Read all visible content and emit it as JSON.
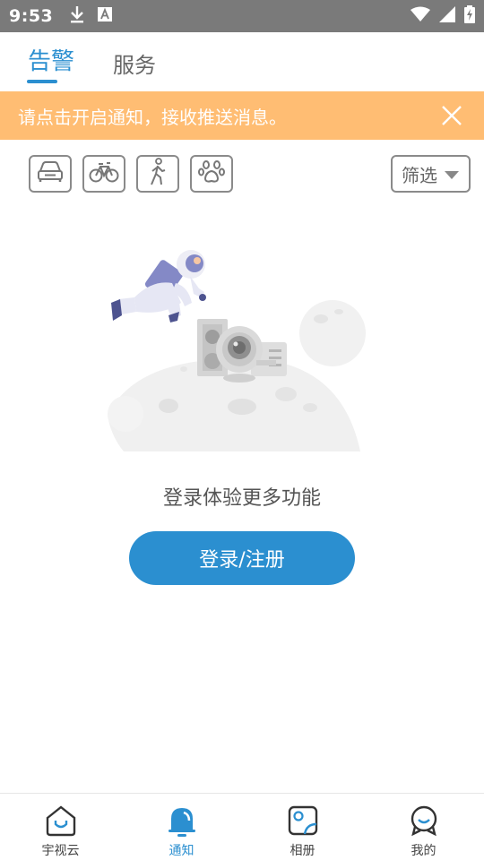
{
  "status_bar": {
    "time": "9:53",
    "left_icons": [
      "download-icon",
      "a-letter-icon"
    ],
    "right_icons": [
      "wifi-icon",
      "signal-icon",
      "battery-charging-icon"
    ]
  },
  "tabs": [
    {
      "label": "告警",
      "active": true
    },
    {
      "label": "服务",
      "active": false
    }
  ],
  "notice": {
    "text": "请点击开启通知，接收推送消息。",
    "close_icon": "close-icon",
    "color": "#ffbd73"
  },
  "filter": {
    "categories": [
      "car-icon",
      "bicycle-icon",
      "pedestrian-icon",
      "paw-icon"
    ],
    "select_label": "筛选"
  },
  "empty_state": {
    "illustration": "astronaut-moon-camera-illustration",
    "message": "登录体验更多功能",
    "button_label": "登录/注册"
  },
  "bottom_nav": [
    {
      "label": "宇视云",
      "icon": "home-icon",
      "active": false
    },
    {
      "label": "通知",
      "icon": "bell-icon",
      "active": true
    },
    {
      "label": "相册",
      "icon": "album-icon",
      "active": false
    },
    {
      "label": "我的",
      "icon": "profile-icon",
      "active": false
    }
  ],
  "colors": {
    "accent": "#2b8fd0",
    "status_bar": "#7a7a7a",
    "notice_bg": "#ffbd73"
  }
}
